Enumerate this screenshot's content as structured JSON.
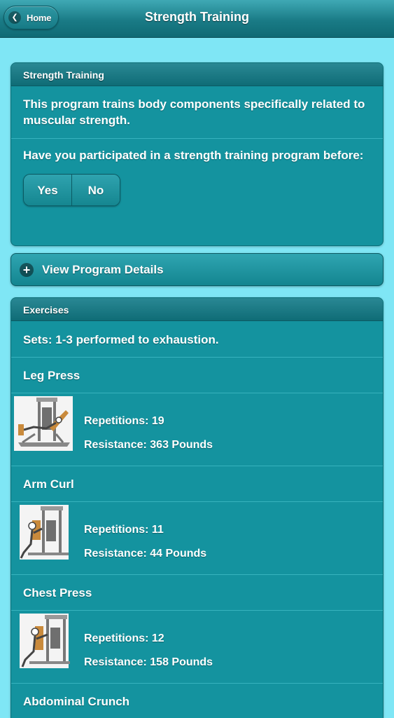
{
  "header": {
    "home_label": "Home",
    "title": "Strength Training"
  },
  "intro_card": {
    "heading": "Strength Training",
    "description": "This program trains body components specifically related to muscular strength.",
    "question": "Have you participated in a strength training program before:",
    "options": [
      "Yes",
      "No"
    ]
  },
  "details": {
    "label": "View Program Details"
  },
  "exercises_card": {
    "heading": "Exercises",
    "sets": "Sets: 1-3 performed to exhaustion.",
    "items": [
      {
        "name": "Leg Press",
        "reps": "Repetitions: 19",
        "resistance": "Resistance: 363 Pounds"
      },
      {
        "name": "Arm Curl",
        "reps": "Repetitions: 11",
        "resistance": "Resistance: 44 Pounds"
      },
      {
        "name": "Chest Press",
        "reps": "Repetitions: 12",
        "resistance": "Resistance: 158 Pounds"
      },
      {
        "name": "Abdominal Crunch"
      }
    ]
  },
  "icons": {
    "back": "chevron-left-icon",
    "expand": "plus-icon"
  },
  "colors": {
    "background": "#7fe6f5",
    "card": "#14939f",
    "header": "#1a7b86"
  }
}
